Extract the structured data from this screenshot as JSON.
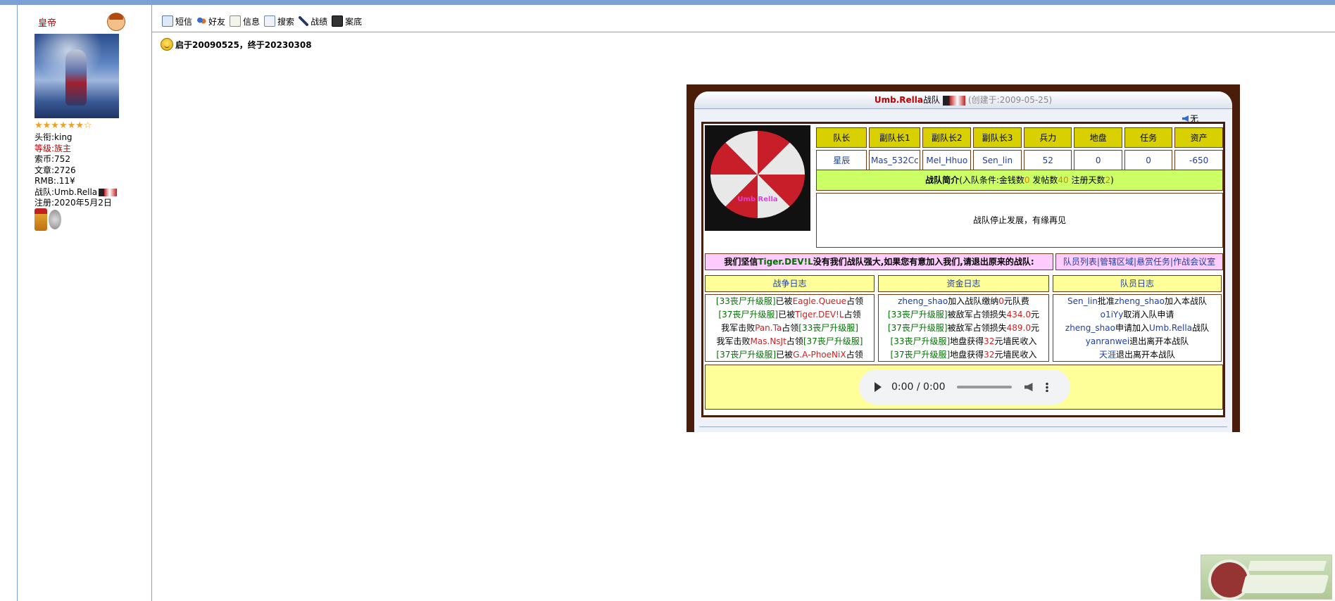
{
  "profile": {
    "username": "皇帝",
    "stars": "★★★★★★☆",
    "info": [
      {
        "label": "头衔:",
        "value": "king",
        "highlight": false
      },
      {
        "label": "等级:",
        "value": "族主",
        "highlight": true
      },
      {
        "label": "索币:",
        "value": "752",
        "highlight": false
      },
      {
        "label": "文章:",
        "value": "2726",
        "highlight": false
      },
      {
        "label": "RMB:",
        "value": ".11¥",
        "highlight": false
      },
      {
        "label": "战队:",
        "value": "Umb.Rella",
        "highlight": false
      },
      {
        "label": "注册:",
        "value": "2020年5月2日",
        "highlight": false
      }
    ]
  },
  "toolbar": {
    "items": [
      {
        "label": "短信",
        "icon": "message-icon"
      },
      {
        "label": "好友",
        "icon": "friends-icon"
      },
      {
        "label": "信息",
        "icon": "info-icon"
      },
      {
        "label": "搜索",
        "icon": "search-icon"
      },
      {
        "label": "战绩",
        "icon": "battle-icon"
      },
      {
        "label": "案底",
        "icon": "record-icon"
      }
    ]
  },
  "signature": "启于20090525，终于20230308",
  "team": {
    "name": "Umb.Rella",
    "suffix": "战队",
    "created": "(创建于:2009-05-25)",
    "mute_label": "无",
    "headers": [
      "队长",
      "副队长1",
      "副队长2",
      "副队长3",
      "兵力",
      "地盘",
      "任务",
      "资产"
    ],
    "values": [
      "星辰",
      "Mas_532Cc",
      "MeI_Hhuo",
      "Sen_lin",
      "52",
      "0",
      "0",
      "-650"
    ],
    "intro_title": "战队简介",
    "intro_cond_prefix": "(入队条件:金钱数",
    "intro_money": "0",
    "intro_posts_label": " 发帖数",
    "intro_posts": "40",
    "intro_days_label": " 注册天数",
    "intro_days": "2",
    "intro_close": ")",
    "intro_body": "战队停止发展，有缘再见",
    "logo_text": "Umb Rella",
    "motto_prefix": "我们坚信",
    "motto_team": "Tiger.DEV!L",
    "motto_suffix": "没有我们战队强大,如果您有意加入我们,请退出原来的战队:",
    "links": [
      "队员列表",
      "|",
      "管辖区域",
      "|",
      "悬赏任务",
      "|",
      "作战会议室"
    ]
  },
  "logs": {
    "war_title": "战争日志",
    "fund_title": "资金日志",
    "member_title": "队员日志",
    "war": [
      [
        [
          "g",
          "[33丧尸升级服]"
        ],
        [
          "k",
          "已被"
        ],
        [
          "r",
          "Eagle.Queue"
        ],
        [
          "k",
          "占领"
        ]
      ],
      [
        [
          "g",
          "[37丧尸升级服]"
        ],
        [
          "k",
          "已被"
        ],
        [
          "r",
          "Tiger.DEV!L"
        ],
        [
          "k",
          "占领"
        ]
      ],
      [
        [
          "k",
          "我军击败"
        ],
        [
          "r",
          "Pan.Ta"
        ],
        [
          "k",
          "占领"
        ],
        [
          "g",
          "[33丧尸升级服]"
        ]
      ],
      [
        [
          "k",
          "我军击败"
        ],
        [
          "r",
          "Mas.NsJt"
        ],
        [
          "k",
          "占领"
        ],
        [
          "g",
          "[37丧尸升级服]"
        ]
      ],
      [
        [
          "g",
          "[37丧尸升级服]"
        ],
        [
          "k",
          "已被"
        ],
        [
          "r",
          "G.A-PhoeNiX"
        ],
        [
          "k",
          "占领"
        ]
      ]
    ],
    "fund": [
      [
        [
          "b",
          "zheng_shao"
        ],
        [
          "k",
          "加入战队缴纳"
        ],
        [
          "r",
          "0"
        ],
        [
          "k",
          "元队费"
        ]
      ],
      [
        [
          "g",
          "[33丧尸升级服]"
        ],
        [
          "k",
          "被敌军占领损失"
        ],
        [
          "r",
          "434.0"
        ],
        [
          "k",
          "元"
        ]
      ],
      [
        [
          "g",
          "[37丧尸升级服]"
        ],
        [
          "k",
          "被敌军占领损失"
        ],
        [
          "r",
          "489.0"
        ],
        [
          "k",
          "元"
        ]
      ],
      [
        [
          "g",
          "[33丧尸升级服]"
        ],
        [
          "k",
          "地盘获得"
        ],
        [
          "r",
          "32"
        ],
        [
          "k",
          "元墙民收入"
        ]
      ],
      [
        [
          "g",
          "[37丧尸升级服]"
        ],
        [
          "k",
          "地盘获得"
        ],
        [
          "r",
          "32"
        ],
        [
          "k",
          "元墙民收入"
        ]
      ]
    ],
    "member": [
      [
        [
          "b",
          "Sen_lin"
        ],
        [
          "k",
          "批准"
        ],
        [
          "b",
          "zheng_shao"
        ],
        [
          "k",
          "加入本战队"
        ]
      ],
      [
        [
          "b",
          "o1iYy"
        ],
        [
          "k",
          "取消入队申请"
        ]
      ],
      [
        [
          "b",
          "zheng_shao"
        ],
        [
          "k",
          "申请加入"
        ],
        [
          "b",
          "Umb.Rella"
        ],
        [
          "k",
          "战队"
        ]
      ],
      [
        [
          "b",
          "yanranwei"
        ],
        [
          "k",
          "退出离开本战队"
        ]
      ],
      [
        [
          "b",
          "天涯"
        ],
        [
          "k",
          "退出离开本战队"
        ]
      ]
    ]
  },
  "player": {
    "time": "0:00 / 0:00"
  }
}
